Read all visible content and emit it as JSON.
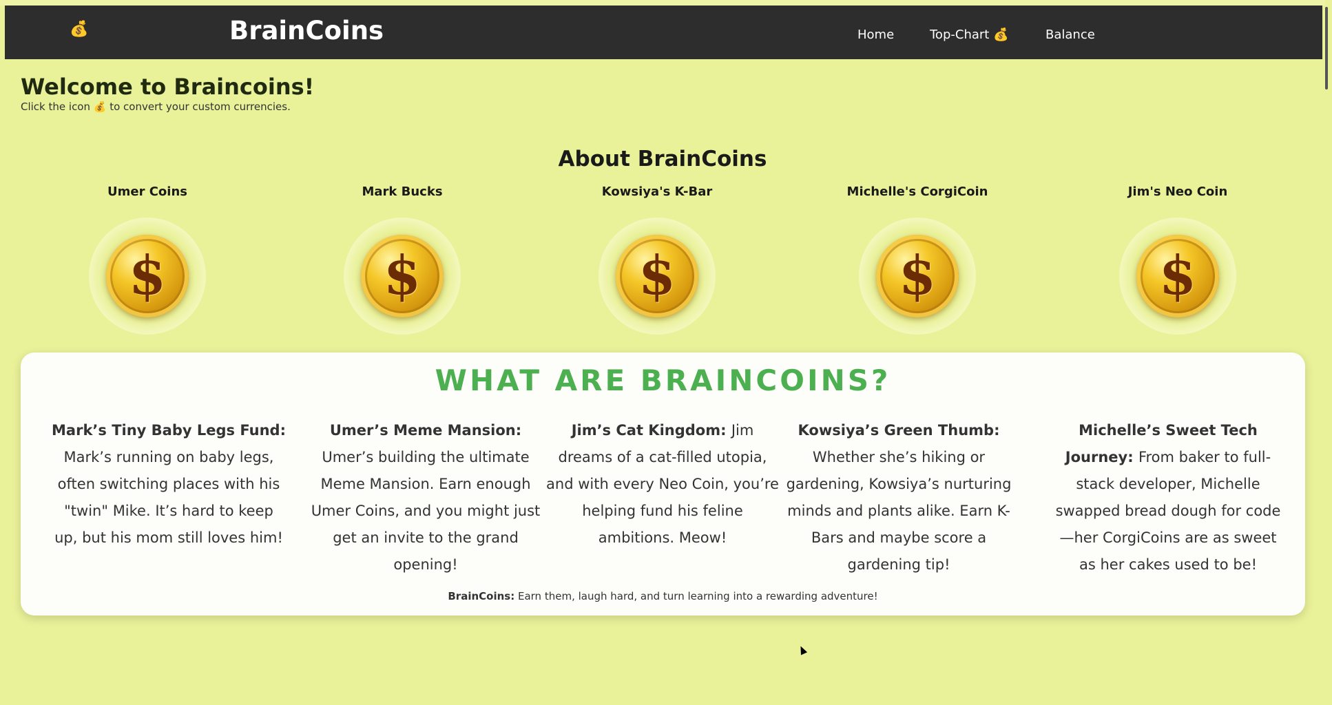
{
  "header": {
    "icon": "money-bag-icon",
    "icon_glyph": "💰",
    "brand": "BrainCoins",
    "nav": [
      {
        "label": "Home"
      },
      {
        "label": "Top-Chart 💰"
      },
      {
        "label": "Balance"
      }
    ]
  },
  "welcome": {
    "title": "Welcome to Braincoins!",
    "subtitle": "Click the icon 💰 to convert your custom currencies."
  },
  "about": {
    "title": "About BrainCoins",
    "coins": [
      {
        "name": "Umer Coins",
        "symbol": "$"
      },
      {
        "name": "Mark Bucks",
        "symbol": "$"
      },
      {
        "name": "Kowsiya's K-Bar",
        "symbol": "$"
      },
      {
        "name": "Michelle's CorgiCoin",
        "symbol": "$"
      },
      {
        "name": "Jim's Neo Coin",
        "symbol": "$"
      }
    ]
  },
  "what": {
    "title": "WHAT ARE BRAINCOINS?",
    "stories": [
      {
        "heading": "Mark’s Tiny Baby Legs Fund:",
        "text": "Mark’s running on baby legs, often switching places with his \"twin\" Mike. It’s hard to keep up, but his mom still loves him!"
      },
      {
        "heading": "Umer’s Meme Mansion:",
        "text": "Umer’s building the ultimate Meme Mansion. Earn enough Umer Coins, and you might just get an invite to the grand opening!"
      },
      {
        "heading": "Jim’s Cat Kingdom:",
        "text": "Jim dreams of a cat-filled utopia, and with every Neo Coin, you’re helping fund his feline ambitions. Meow!"
      },
      {
        "heading": "Kowsiya’s Green Thumb:",
        "text": "Whether she’s hiking or gardening, Kowsiya’s nurturing minds and plants alike. Earn K-Bars and maybe score a gardening tip!"
      },
      {
        "heading": "Michelle’s Sweet Tech Journey:",
        "text": "From baker to full-stack developer, Michelle swapped bread dough for code—her CorgiCoins are as sweet as her cakes used to be!"
      }
    ],
    "footer_bold": "BrainCoins:",
    "footer_text": " Earn them, laugh hard, and turn learning into a rewarding adventure!"
  },
  "colors": {
    "page_bg": "#e9f199",
    "navbar_bg": "#2d2d2d",
    "accent_green": "#4caf50",
    "panel_bg": "#fdfdf9"
  }
}
